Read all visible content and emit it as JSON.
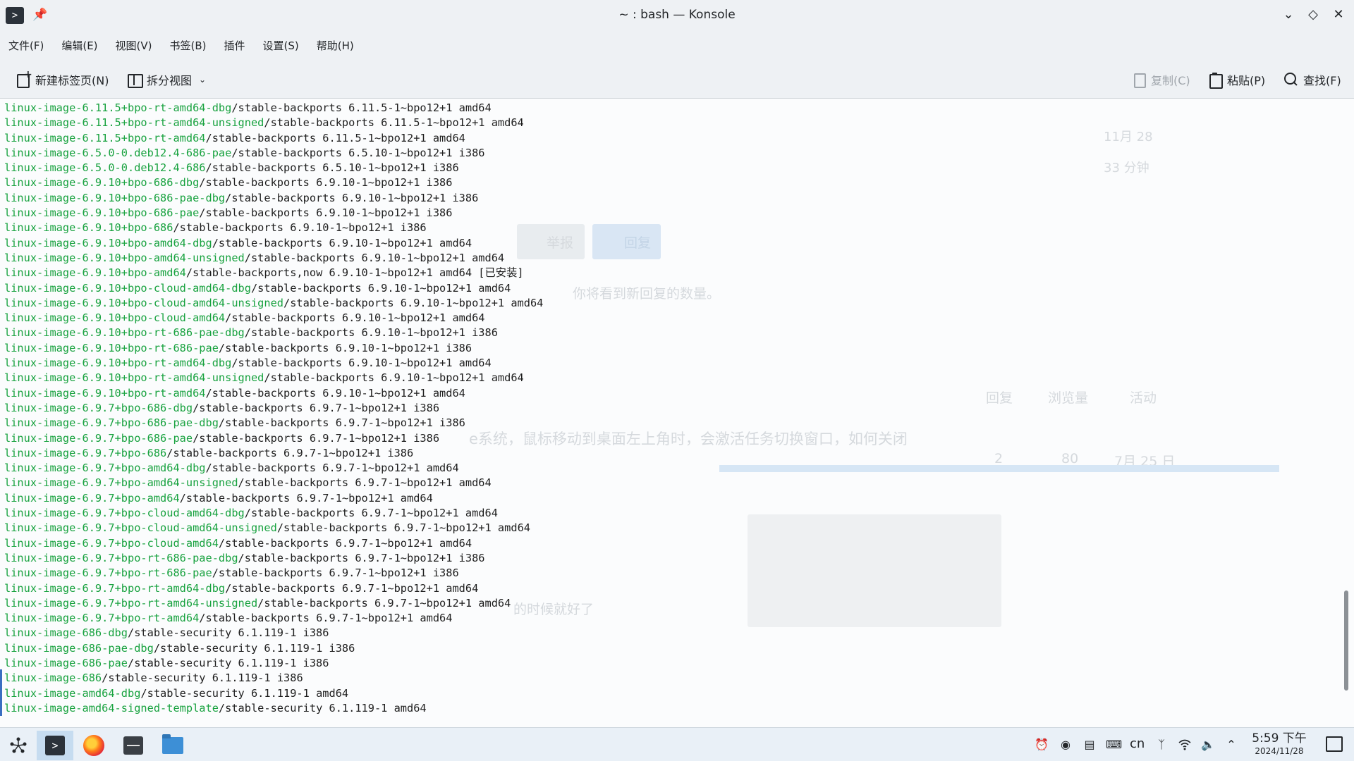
{
  "window": {
    "title": "~ : bash — Konsole",
    "app_icon_glyph": ">",
    "pin_glyph": "📌"
  },
  "menu": [
    "文件(F)",
    "编辑(E)",
    "视图(V)",
    "书签(B)",
    "插件",
    "设置(S)",
    "帮助(H)"
  ],
  "toolbar": {
    "new_tab": "新建标签页(N)",
    "split_view": "拆分视图",
    "copy": "复制(C)",
    "paste": "粘贴(P)",
    "find": "查找(F)"
  },
  "terminal": {
    "lines": [
      {
        "pkg": "linux-image-6.11.5+bpo-rt-amd64-dbg",
        "rest": "/stable-backports 6.11.5-1~bpo12+1 amd64"
      },
      {
        "pkg": "linux-image-6.11.5+bpo-rt-amd64-unsigned",
        "rest": "/stable-backports 6.11.5-1~bpo12+1 amd64"
      },
      {
        "pkg": "linux-image-6.11.5+bpo-rt-amd64",
        "rest": "/stable-backports 6.11.5-1~bpo12+1 amd64"
      },
      {
        "pkg": "linux-image-6.5.0-0.deb12.4-686-pae",
        "rest": "/stable-backports 6.5.10-1~bpo12+1 i386"
      },
      {
        "pkg": "linux-image-6.5.0-0.deb12.4-686",
        "rest": "/stable-backports 6.5.10-1~bpo12+1 i386"
      },
      {
        "pkg": "linux-image-6.9.10+bpo-686-dbg",
        "rest": "/stable-backports 6.9.10-1~bpo12+1 i386"
      },
      {
        "pkg": "linux-image-6.9.10+bpo-686-pae-dbg",
        "rest": "/stable-backports 6.9.10-1~bpo12+1 i386"
      },
      {
        "pkg": "linux-image-6.9.10+bpo-686-pae",
        "rest": "/stable-backports 6.9.10-1~bpo12+1 i386"
      },
      {
        "pkg": "linux-image-6.9.10+bpo-686",
        "rest": "/stable-backports 6.9.10-1~bpo12+1 i386"
      },
      {
        "pkg": "linux-image-6.9.10+bpo-amd64-dbg",
        "rest": "/stable-backports 6.9.10-1~bpo12+1 amd64"
      },
      {
        "pkg": "linux-image-6.9.10+bpo-amd64-unsigned",
        "rest": "/stable-backports 6.9.10-1~bpo12+1 amd64"
      },
      {
        "pkg": "linux-image-6.9.10+bpo-amd64",
        "rest": "/stable-backports,now 6.9.10-1~bpo12+1 amd64 [已安装]"
      },
      {
        "pkg": "linux-image-6.9.10+bpo-cloud-amd64-dbg",
        "rest": "/stable-backports 6.9.10-1~bpo12+1 amd64"
      },
      {
        "pkg": "linux-image-6.9.10+bpo-cloud-amd64-unsigned",
        "rest": "/stable-backports 6.9.10-1~bpo12+1 amd64"
      },
      {
        "pkg": "linux-image-6.9.10+bpo-cloud-amd64",
        "rest": "/stable-backports 6.9.10-1~bpo12+1 amd64"
      },
      {
        "pkg": "linux-image-6.9.10+bpo-rt-686-pae-dbg",
        "rest": "/stable-backports 6.9.10-1~bpo12+1 i386"
      },
      {
        "pkg": "linux-image-6.9.10+bpo-rt-686-pae",
        "rest": "/stable-backports 6.9.10-1~bpo12+1 i386"
      },
      {
        "pkg": "linux-image-6.9.10+bpo-rt-amd64-dbg",
        "rest": "/stable-backports 6.9.10-1~bpo12+1 amd64"
      },
      {
        "pkg": "linux-image-6.9.10+bpo-rt-amd64-unsigned",
        "rest": "/stable-backports 6.9.10-1~bpo12+1 amd64"
      },
      {
        "pkg": "linux-image-6.9.10+bpo-rt-amd64",
        "rest": "/stable-backports 6.9.10-1~bpo12+1 amd64"
      },
      {
        "pkg": "linux-image-6.9.7+bpo-686-dbg",
        "rest": "/stable-backports 6.9.7-1~bpo12+1 i386"
      },
      {
        "pkg": "linux-image-6.9.7+bpo-686-pae-dbg",
        "rest": "/stable-backports 6.9.7-1~bpo12+1 i386"
      },
      {
        "pkg": "linux-image-6.9.7+bpo-686-pae",
        "rest": "/stable-backports 6.9.7-1~bpo12+1 i386"
      },
      {
        "pkg": "linux-image-6.9.7+bpo-686",
        "rest": "/stable-backports 6.9.7-1~bpo12+1 i386"
      },
      {
        "pkg": "linux-image-6.9.7+bpo-amd64-dbg",
        "rest": "/stable-backports 6.9.7-1~bpo12+1 amd64"
      },
      {
        "pkg": "linux-image-6.9.7+bpo-amd64-unsigned",
        "rest": "/stable-backports 6.9.7-1~bpo12+1 amd64"
      },
      {
        "pkg": "linux-image-6.9.7+bpo-amd64",
        "rest": "/stable-backports 6.9.7-1~bpo12+1 amd64"
      },
      {
        "pkg": "linux-image-6.9.7+bpo-cloud-amd64-dbg",
        "rest": "/stable-backports 6.9.7-1~bpo12+1 amd64"
      },
      {
        "pkg": "linux-image-6.9.7+bpo-cloud-amd64-unsigned",
        "rest": "/stable-backports 6.9.7-1~bpo12+1 amd64"
      },
      {
        "pkg": "linux-image-6.9.7+bpo-cloud-amd64",
        "rest": "/stable-backports 6.9.7-1~bpo12+1 amd64"
      },
      {
        "pkg": "linux-image-6.9.7+bpo-rt-686-pae-dbg",
        "rest": "/stable-backports 6.9.7-1~bpo12+1 i386"
      },
      {
        "pkg": "linux-image-6.9.7+bpo-rt-686-pae",
        "rest": "/stable-backports 6.9.7-1~bpo12+1 i386"
      },
      {
        "pkg": "linux-image-6.9.7+bpo-rt-amd64-dbg",
        "rest": "/stable-backports 6.9.7-1~bpo12+1 amd64"
      },
      {
        "pkg": "linux-image-6.9.7+bpo-rt-amd64-unsigned",
        "rest": "/stable-backports 6.9.7-1~bpo12+1 amd64"
      },
      {
        "pkg": "linux-image-6.9.7+bpo-rt-amd64",
        "rest": "/stable-backports 6.9.7-1~bpo12+1 amd64"
      },
      {
        "pkg": "linux-image-686-dbg",
        "rest": "/stable-security 6.1.119-1 i386"
      },
      {
        "pkg": "linux-image-686-pae-dbg",
        "rest": "/stable-security 6.1.119-1 i386"
      },
      {
        "pkg": "linux-image-686-pae",
        "rest": "/stable-security 6.1.119-1 i386"
      },
      {
        "pkg": "linux-image-686",
        "rest": "/stable-security 6.1.119-1 i386"
      },
      {
        "pkg": "linux-image-amd64-dbg",
        "rest": "/stable-security 6.1.119-1 amd64"
      },
      {
        "pkg": "linux-image-amd64-signed-template",
        "rest": "/stable-security 6.1.119-1 amd64"
      }
    ]
  },
  "background_ghost": {
    "date": "11月 28",
    "minutes": "33 分钟",
    "report": "举报",
    "reply": "回复",
    "notice": "你将看到新回复的数量。",
    "col_reply": "回复",
    "col_views": "浏览量",
    "col_activity": "活动",
    "topic": "e系统，鼠标移动到桌面左上角时，会激活任务切换窗口，如何关闭",
    "topic_replies": "2",
    "topic_views": "80",
    "topic_date": "7月 25 日",
    "misc_text": "的时候就好了"
  },
  "taskbar": {
    "tray_lang": "cn",
    "clock_time": "5:59 下午",
    "clock_date": "2024/11/28"
  },
  "colors": {
    "package_name": "#18a23f",
    "accent": "#3a6ec1"
  }
}
